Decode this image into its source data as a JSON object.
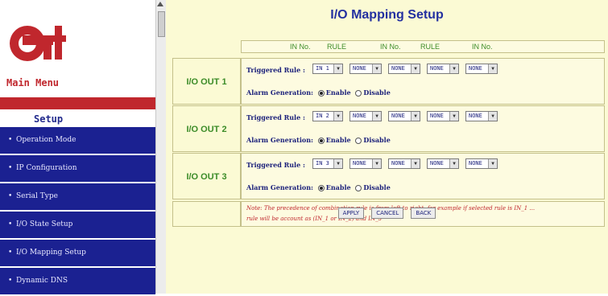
{
  "nav": {
    "menu_title": "Main Menu",
    "setup_label": "Setup",
    "items": [
      {
        "label": "Operation Mode"
      },
      {
        "label": "IP Configuration"
      },
      {
        "label": "Serial Type"
      },
      {
        "label": "I/O State Setup"
      },
      {
        "label": "I/O Mapping Setup"
      },
      {
        "label": "Dynamic DNS"
      }
    ]
  },
  "page": {
    "title": "I/O Mapping Setup"
  },
  "header": {
    "cols": [
      "IN No.",
      "RULE",
      "IN No.",
      "RULE",
      "IN No."
    ]
  },
  "outputs": [
    {
      "label": "I/O OUT 1",
      "triggered_label": "Triggered Rule :",
      "selects": [
        "IN 1",
        "NONE",
        "NONE",
        "NONE",
        "NONE"
      ],
      "alarm_label": "Alarm Generation:",
      "enable_label": "Enable",
      "disable_label": "Disable"
    },
    {
      "label": "I/O OUT 2",
      "triggered_label": "Triggered Rule :",
      "selects": [
        "IN 2",
        "NONE",
        "NONE",
        "NONE",
        "NONE"
      ],
      "alarm_label": "Alarm Generation:",
      "enable_label": "Enable",
      "disable_label": "Disable"
    },
    {
      "label": "I/O OUT 3",
      "triggered_label": "Triggered Rule :",
      "selects": [
        "IN 3",
        "NONE",
        "NONE",
        "NONE",
        "NONE"
      ],
      "alarm_label": "Alarm Generation:",
      "enable_label": "Enable",
      "disable_label": "Disable"
    }
  ],
  "note": {
    "line1": "Note: The precedence of combination rule is from left to right, for example if selected rule is IN_1 ...",
    "line2": "rule will be account as (IN_1 or IN_2) and IN_3"
  },
  "buttons": {
    "apply": "APPLY",
    "cancel": "CANCEL",
    "back": "BACK"
  },
  "colors": {
    "accent_red": "#c0272d",
    "nav_blue": "#1b2191",
    "label_green": "#3c8c28",
    "panel_bg": "#fbfad4"
  }
}
